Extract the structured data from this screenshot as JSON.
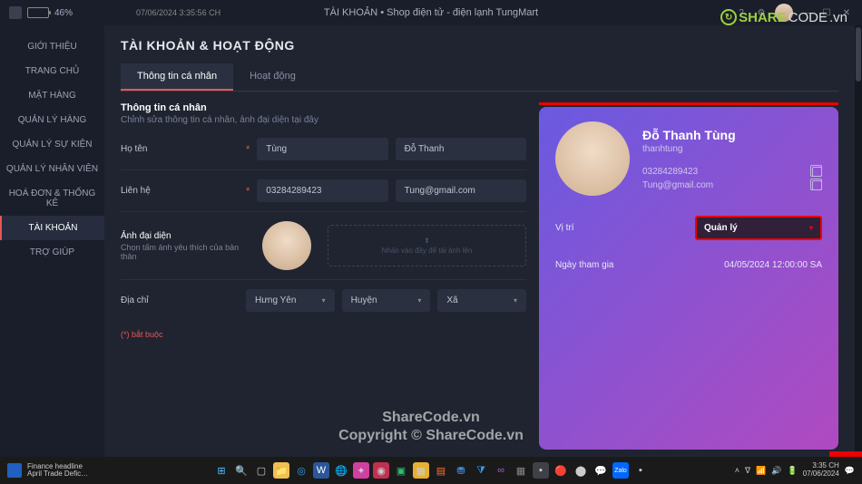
{
  "titlebar": {
    "battery_pct": "46%",
    "timestamp": "07/06/2024 3:35:56 CH",
    "title": "TÀI KHOẢN • Shop điện tử - điện lạnh TungMart"
  },
  "watermarks": {
    "logo1": "SHARE",
    "logo1b": "CODE",
    "logo1c": ".vn",
    "line1": "ShareCode.vn",
    "line2": "Copyright © ShareCode.vn"
  },
  "sidebar": {
    "items": [
      "GIỚI THIỆU",
      "TRANG CHỦ",
      "MẶT HÀNG",
      "QUẢN LÝ HÀNG",
      "QUẢN LÝ SỰ KIỆN",
      "QUẢN LÝ NHÂN VIÊN",
      "HOÁ ĐƠN & THỐNG KÊ",
      "TÀI KHOẢN",
      "TRỢ GIÚP"
    ]
  },
  "page": {
    "title": "TÀI KHOẢN & HOẠT ĐỘNG"
  },
  "tabs": {
    "t1": "Thông tin cá nhân",
    "t2": "Hoạt động"
  },
  "form": {
    "section_title": "Thông tin cá nhân",
    "section_sub": "Chỉnh sửa thông tin cá nhân, ảnh đại diện tại đây",
    "name_lbl": "Họ tên",
    "name_first": "Tùng",
    "name_last": "Đỗ Thanh",
    "contact_lbl": "Liên hệ",
    "phone": "03284289423",
    "email": "Tung@gmail.com",
    "avatar_lbl": "Ảnh đại diện",
    "avatar_sub": "Chọn tấm ảnh yêu thích của bản thân",
    "upload_hint": "Nhấn vào đây để tải ảnh lên",
    "addr_lbl": "Địa chỉ",
    "province": "Hưng Yên",
    "district": "Huyện",
    "ward": "Xã",
    "req_note": "(*) bắt buộc"
  },
  "card": {
    "name": "Đỗ Thanh Tùng",
    "username": "thanhtung",
    "phone": "03284289423",
    "email": "Tung@gmail.com",
    "position_lbl": "Vị trí",
    "position_val": "Quản lý",
    "joined_lbl": "Ngày tham gia",
    "joined_val": "04/05/2024 12:00:00 SA"
  },
  "taskbar": {
    "news_h": "Finance headline",
    "news_s": "April Trade Defic…",
    "time": "3:35 CH",
    "date": "07/06/2024"
  }
}
